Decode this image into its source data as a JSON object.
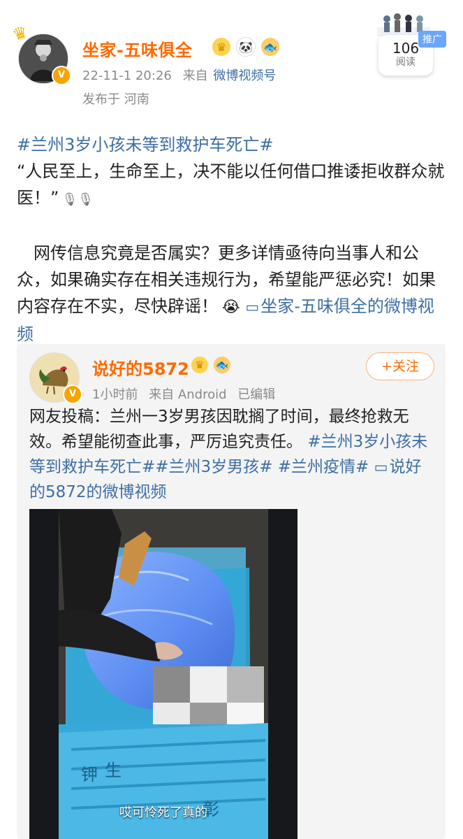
{
  "post": {
    "username": "坐家-五味俱全",
    "timestamp": "22-11-1 20:26",
    "source_prefix": "来自",
    "source": "微博视频号",
    "location": "发布于 河南",
    "read_count": "106",
    "read_label": "阅读",
    "promo": "推广",
    "hashtag": "#兰州3岁小孩未等到救护车死亡#",
    "quote_line": "“人民至上，生命至上，决不能以任何借口推诿拒收群众就医！”",
    "quote_icons": "🎙🎙",
    "body": "网传信息究竟是否属实？更多详情亟待向当事人和公众，如果确实存在相关违规行为，希望能严惩必究！如果内容存在不实，尽快辟谣！",
    "body_emoji": "😭",
    "video_icon": "▭",
    "video_link": "坐家-五味俱全的微博视频"
  },
  "embed": {
    "username": "说好的5872",
    "timestamp": "1小时前",
    "source_prefix": "来自",
    "source": "Android",
    "edited": "已编辑",
    "follow_label": "+关注",
    "text_prefix": "网友投稿：兰州一3岁男孩因耽搁了时间，最终抢救无效。希望能彻查此事，严厉追究责任。",
    "hashtag1": "#兰州3岁小孩未等到救护车死亡#",
    "hashtag2": "#兰州3岁男孩#",
    "hashtag3": "#兰州疫情#",
    "video_icon": "▭",
    "video_link": "说好的5872的微博视频",
    "subtitle": "哎可怜死了真的"
  },
  "icons": {
    "crown": "crown-icon",
    "panda": "panda-icon",
    "fish": "fish-icon",
    "verify": "verified-icon",
    "mic": "microphone-icon",
    "video": "video-icon"
  },
  "colors": {
    "username": "#ff6a00",
    "link": "#3d6ea5",
    "meta": "#8a8a8a",
    "verify": "#f6a400"
  }
}
